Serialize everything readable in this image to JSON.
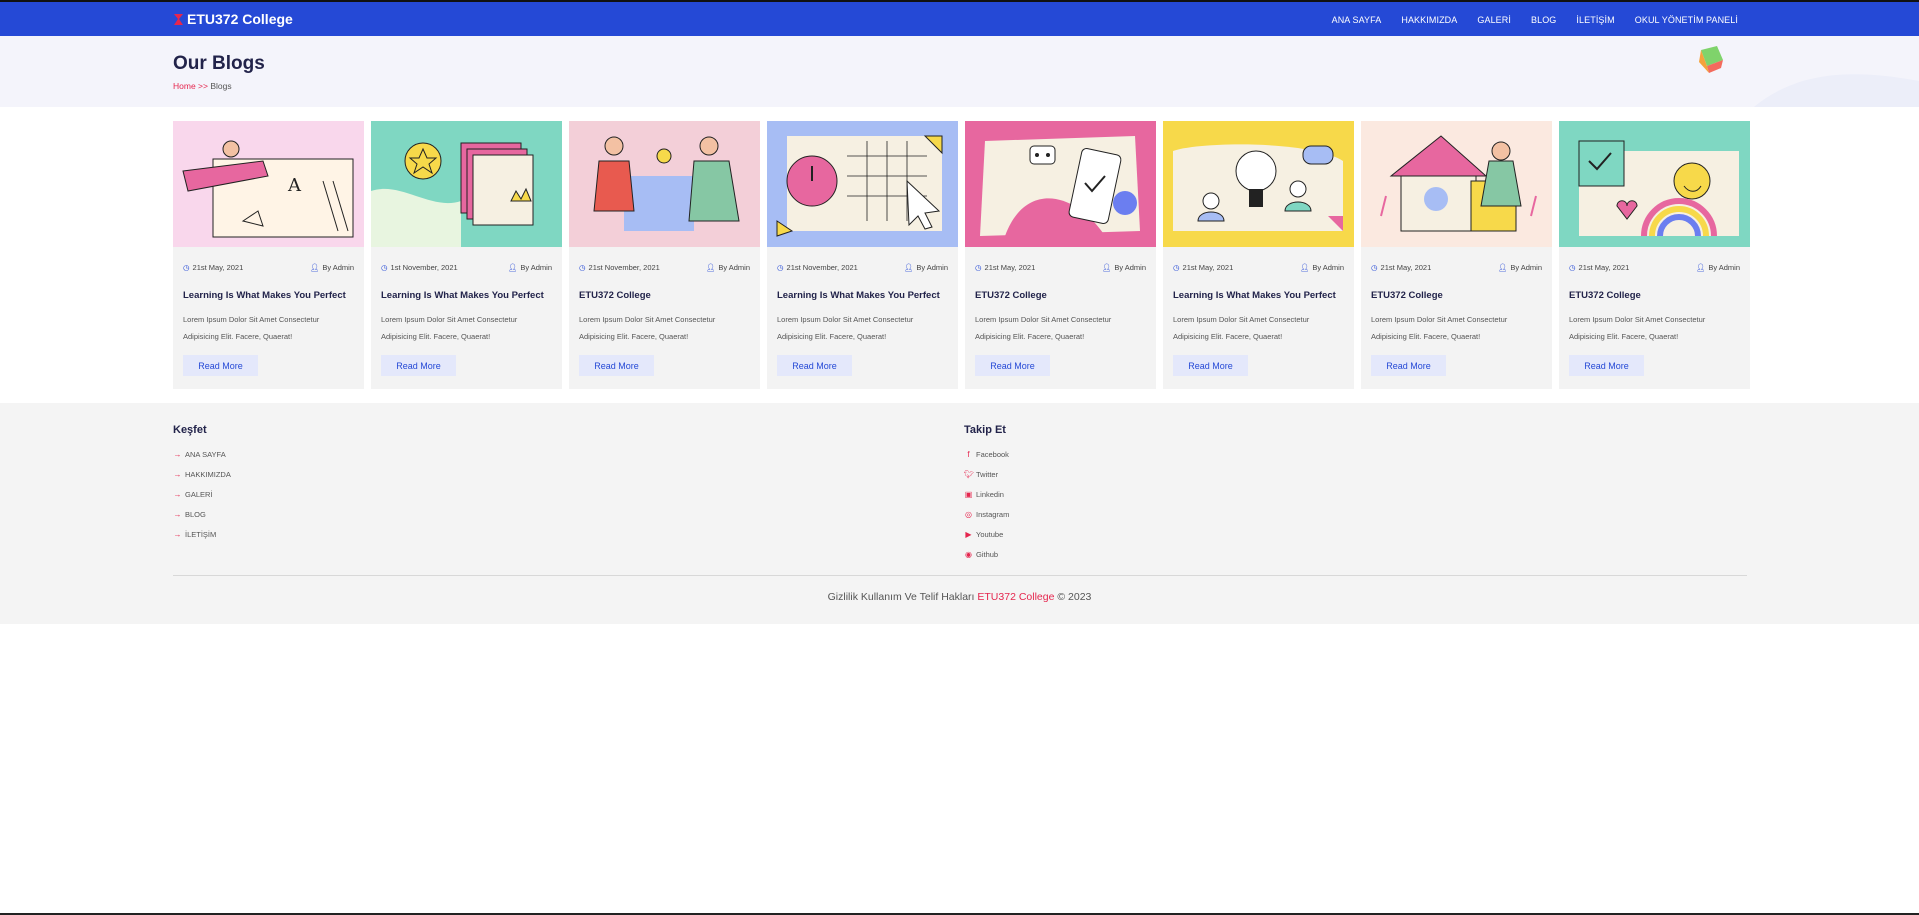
{
  "brand": {
    "name": "ETU372 College",
    "logo_icon": "graduation-logo-icon",
    "accent": "#e5264e"
  },
  "nav": {
    "items": [
      "ANA SAYFA",
      "HAKKIMIZDA",
      "GALERİ",
      "BLOG",
      "İLETİŞİM",
      "OKUL YÖNETİM PANELİ"
    ],
    "bg_color": "#2549d6"
  },
  "hero": {
    "title": "Our Blogs",
    "breadcrumb_home": "Home >>",
    "breadcrumb_current": "Blogs"
  },
  "cards": [
    {
      "date": "21st May, 2021",
      "author": "By Admin",
      "title": "Learning Is What Makes You Perfect",
      "excerpt": "Lorem Ipsum Dolor Sit Amet Consectetur Adipisicing Elit. Facere, Quaerat!",
      "button": "Read More",
      "bg": "#f9d7ec"
    },
    {
      "date": "1st November, 2021",
      "author": "By Admin",
      "title": "Learning Is What Makes You Perfect",
      "excerpt": "Lorem Ipsum Dolor Sit Amet Consectetur Adipisicing Elit. Facere, Quaerat!",
      "button": "Read More",
      "bg": "#7fd7c2"
    },
    {
      "date": "21st November, 2021",
      "author": "By Admin",
      "title": "ETU372 College",
      "excerpt": "Lorem Ipsum Dolor Sit Amet Consectetur Adipisicing Elit. Facere, Quaerat!",
      "button": "Read More",
      "bg": "#f3cfd8"
    },
    {
      "date": "21st November, 2021",
      "author": "By Admin",
      "title": "Learning Is What Makes You Perfect",
      "excerpt": "Lorem Ipsum Dolor Sit Amet Consectetur Adipisicing Elit. Facere, Quaerat!",
      "button": "Read More",
      "bg": "#a7bdf4"
    },
    {
      "date": "21st May, 2021",
      "author": "By Admin",
      "title": "ETU372 College",
      "excerpt": "Lorem Ipsum Dolor Sit Amet Consectetur Adipisicing Elit. Facere, Quaerat!",
      "button": "Read More",
      "bg": "#e7679f"
    },
    {
      "date": "21st May, 2021",
      "author": "By Admin",
      "title": "Learning Is What Makes You Perfect",
      "excerpt": "Lorem Ipsum Dolor Sit Amet Consectetur Adipisicing Elit. Facere, Quaerat!",
      "button": "Read More",
      "bg": "#f7d94a"
    },
    {
      "date": "21st May, 2021",
      "author": "By Admin",
      "title": "ETU372 College",
      "excerpt": "Lorem Ipsum Dolor Sit Amet Consectetur Adipisicing Elit. Facere, Quaerat!",
      "button": "Read More",
      "bg": "#fbe9e0"
    },
    {
      "date": "21st May, 2021",
      "author": "By Admin",
      "title": "ETU372 College",
      "excerpt": "Lorem Ipsum Dolor Sit Amet Consectetur Adipisicing Elit. Facere, Quaerat!",
      "button": "Read More",
      "bg": "#7fd7c2"
    }
  ],
  "footer": {
    "explore": {
      "title": "Keşfet",
      "links": [
        "ANA SAYFA",
        "HAKKIMIZDA",
        "GALERİ",
        "BLOG",
        "İLETİŞİM"
      ]
    },
    "follow": {
      "title": "Takip Et",
      "links": [
        {
          "label": "Facebook",
          "icon": "facebook-icon"
        },
        {
          "label": "Twitter",
          "icon": "twitter-icon"
        },
        {
          "label": "Linkedin",
          "icon": "linkedin-icon"
        },
        {
          "label": "Instagram",
          "icon": "instagram-icon"
        },
        {
          "label": "Youtube",
          "icon": "youtube-icon"
        },
        {
          "label": "Github",
          "icon": "github-icon"
        }
      ]
    },
    "copyright_prefix": "Gizlilik Kullanım Ve Telif Hakları",
    "copyright_brand": "ETU372 College",
    "copyright_suffix": "© 2023"
  }
}
